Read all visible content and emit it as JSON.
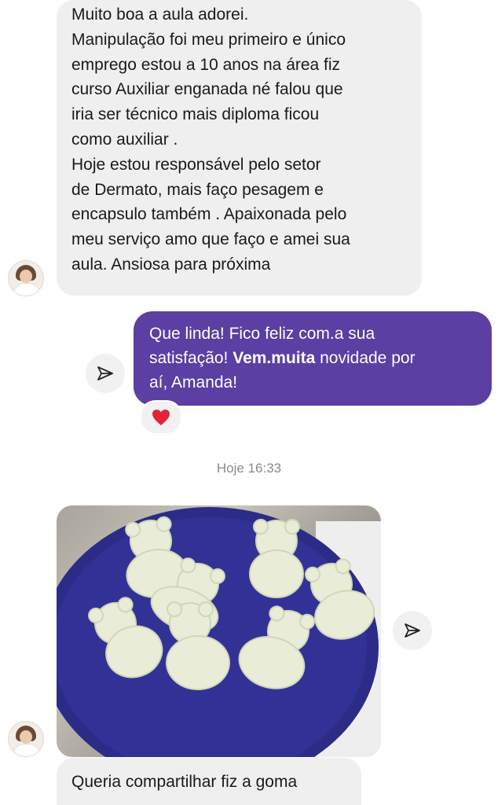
{
  "messages": {
    "received_1": {
      "lines": [
        "Muito boa a aula adorei.",
        "Manipulação foi meu primeiro e único",
        "emprego estou a 10 anos na área fiz",
        "curso Auxiliar enganada né falou que",
        "iria ser técnico mais diploma ficou",
        "como auxiliar .",
        "Hoje estou responsável pelo setor",
        "de Dermato, mais faço pesagem e",
        "encapsulo também . Apaixonada pelo",
        "meu serviço amo que faço e amei sua",
        "aula. Ansiosa para próxima"
      ]
    },
    "sent_1": {
      "line1": "Que linda! Fico feliz com.a sua",
      "line2_pre": "satisfação! ",
      "line2_bold": "Vem.muita",
      "line2_post": " novidade por",
      "line3": "aí, Amanda!",
      "reaction": "❤"
    },
    "timestamp": "Hoje 16:33",
    "received_2": {
      "text": "Queria compartilhar fiz a goma"
    }
  },
  "icons": {
    "share": "send-icon",
    "avatar": "contact-avatar"
  },
  "colors": {
    "sent_bubble": "#5b3fa3",
    "received_bubble": "#efefef",
    "plate": "#2c2c88",
    "heart": "#e0243a"
  }
}
